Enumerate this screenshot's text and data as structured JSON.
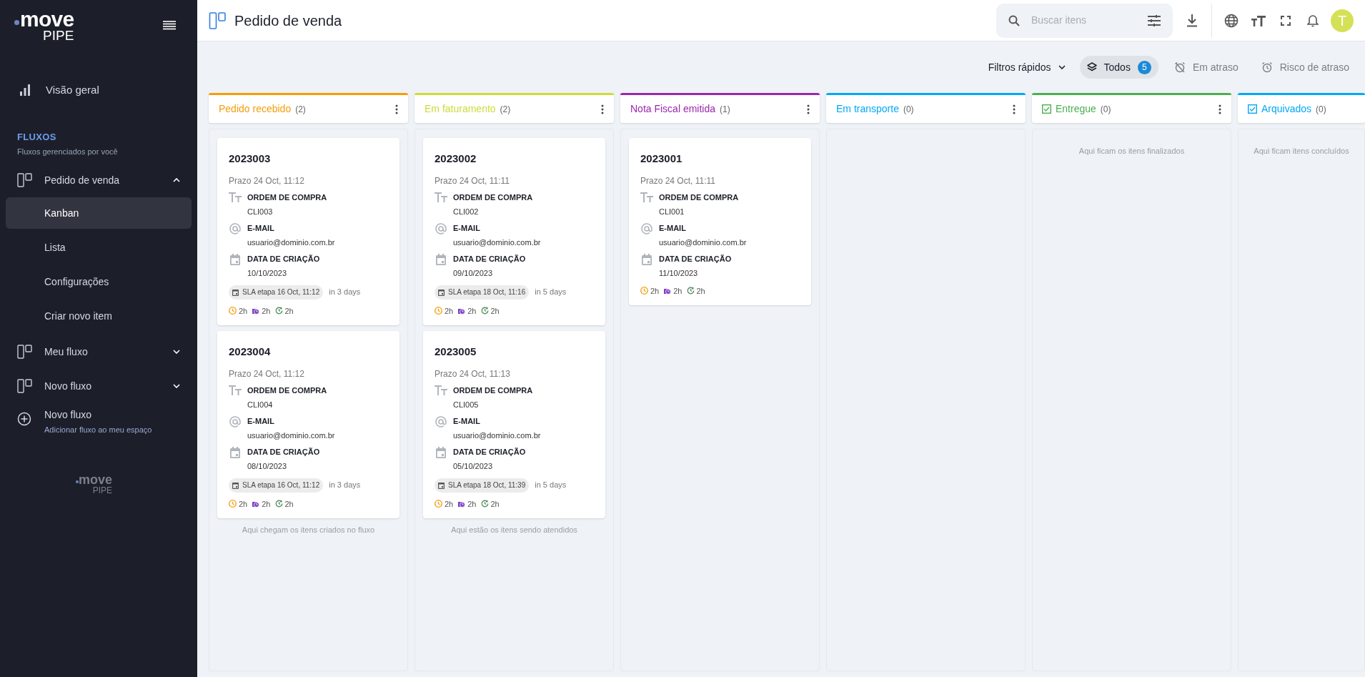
{
  "sidebar": {
    "logo": {
      "word": "move",
      "sub": "PIPE"
    },
    "overview": {
      "label": "Visão geral"
    },
    "section": {
      "title": "FLUXOS",
      "subtitle": "Fluxos gerenciados por você"
    },
    "flows": [
      {
        "label": "Pedido de venda",
        "expanded": true,
        "children": [
          {
            "label": "Kanban",
            "selected": true
          },
          {
            "label": "Lista",
            "selected": false
          },
          {
            "label": "Configurações",
            "selected": false
          },
          {
            "label": "Criar novo item",
            "selected": false
          }
        ]
      },
      {
        "label": "Meu fluxo",
        "expanded": false
      },
      {
        "label": "Novo fluxo",
        "expanded": false
      }
    ],
    "add_flow": {
      "label": "Novo fluxo",
      "subtitle": "Adicionar fluxo ao meu espaço"
    },
    "footer_logo": {
      "word": "move",
      "sub": "PIPE"
    }
  },
  "header": {
    "title": "Pedido de venda",
    "search": {
      "placeholder": "Buscar itens"
    },
    "avatar": "T"
  },
  "filters": {
    "quick": "Filtros rápidos",
    "chips": [
      {
        "kind": "all",
        "label": "Todos",
        "count": "5",
        "selected": true
      },
      {
        "kind": "late",
        "label": "Em atraso",
        "selected": false
      },
      {
        "kind": "risk",
        "label": "Risco de atraso",
        "selected": false
      }
    ]
  },
  "columns": [
    {
      "title": "Pedido recebido",
      "count": "(2)",
      "color": "#f59e0b",
      "done": false,
      "menu": true,
      "hint": "Aqui chegam os itens criados no fluxo",
      "cards": [
        {
          "id": "2023003",
          "deadline": "Prazo 24 Oct, 11:12",
          "fields": [
            {
              "kind": "text",
              "label": "ORDEM DE COMPRA",
              "value": "CLI003"
            },
            {
              "kind": "email",
              "label": "E-MAIL",
              "value": "usuario@dominio.com.br"
            },
            {
              "kind": "date",
              "label": "DATA DE CRIAÇÃO",
              "value": "10/10/2023"
            }
          ],
          "sla": "SLA etapa 16 Oct, 11:12",
          "due": "in 3 days",
          "timers": [
            {
              "kind": "clock",
              "value": "2h"
            },
            {
              "kind": "bag",
              "value": "2h"
            },
            {
              "kind": "refresh",
              "value": "2h"
            }
          ]
        },
        {
          "id": "2023004",
          "deadline": "Prazo 24 Oct, 11:12",
          "fields": [
            {
              "kind": "text",
              "label": "ORDEM DE COMPRA",
              "value": "CLI004"
            },
            {
              "kind": "email",
              "label": "E-MAIL",
              "value": "usuario@dominio.com.br"
            },
            {
              "kind": "date",
              "label": "DATA DE CRIAÇÃO",
              "value": "08/10/2023"
            }
          ],
          "sla": "SLA etapa 16 Oct, 11:12",
          "due": "in 3 days",
          "timers": [
            {
              "kind": "clock",
              "value": "2h"
            },
            {
              "kind": "bag",
              "value": "2h"
            },
            {
              "kind": "refresh",
              "value": "2h"
            }
          ]
        }
      ]
    },
    {
      "title": "Em faturamento",
      "count": "(2)",
      "color": "#cddc39",
      "done": false,
      "menu": true,
      "hint": "Aqui estão os itens sendo atendidos",
      "cards": [
        {
          "id": "2023002",
          "deadline": "Prazo 24 Oct, 11:11",
          "fields": [
            {
              "kind": "text",
              "label": "ORDEM DE COMPRA",
              "value": "CLI002"
            },
            {
              "kind": "email",
              "label": "E-MAIL",
              "value": "usuario@dominio.com.br"
            },
            {
              "kind": "date",
              "label": "DATA DE CRIAÇÃO",
              "value": "09/10/2023"
            }
          ],
          "sla": "SLA etapa 18 Oct, 11:16",
          "due": "in 5 days",
          "timers": [
            {
              "kind": "clock",
              "value": "2h"
            },
            {
              "kind": "bag",
              "value": "2h"
            },
            {
              "kind": "refresh",
              "value": "2h"
            }
          ]
        },
        {
          "id": "2023005",
          "deadline": "Prazo 24 Oct, 11:13",
          "fields": [
            {
              "kind": "text",
              "label": "ORDEM DE COMPRA",
              "value": "CLI005"
            },
            {
              "kind": "email",
              "label": "E-MAIL",
              "value": "usuario@dominio.com.br"
            },
            {
              "kind": "date",
              "label": "DATA DE CRIAÇÃO",
              "value": "05/10/2023"
            }
          ],
          "sla": "SLA etapa 18 Oct, 11:39",
          "due": "in 5 days",
          "timers": [
            {
              "kind": "clock",
              "value": "2h"
            },
            {
              "kind": "bag",
              "value": "2h"
            },
            {
              "kind": "refresh",
              "value": "2h"
            }
          ]
        }
      ]
    },
    {
      "title": "Nota Fiscal emitida",
      "count": "(1)",
      "color": "#9c27b0",
      "done": false,
      "menu": true,
      "cards": [
        {
          "id": "2023001",
          "deadline": "Prazo 24 Oct, 11:11",
          "fields": [
            {
              "kind": "text",
              "label": "ORDEM DE COMPRA",
              "value": "CLI001"
            },
            {
              "kind": "email",
              "label": "E-MAIL",
              "value": "usuario@dominio.com.br"
            },
            {
              "kind": "date",
              "label": "DATA DE CRIAÇÃO",
              "value": "11/10/2023"
            }
          ],
          "timers": [
            {
              "kind": "clock",
              "value": "2h"
            },
            {
              "kind": "bag",
              "value": "2h"
            },
            {
              "kind": "refresh",
              "value": "2h"
            }
          ]
        }
      ]
    },
    {
      "title": "Em transporte",
      "count": "(0)",
      "color": "#03a9f4",
      "done": false,
      "menu": true
    },
    {
      "title": "Entregue",
      "count": "(0)",
      "color": "#4caf50",
      "done": true,
      "menu": true,
      "hint": "Aqui ficam os itens finalizados"
    },
    {
      "title": "Arquivados",
      "count": "(0)",
      "color": "#03a9f4",
      "done": true,
      "menu": false,
      "hint": "Aqui ficam itens concluídos"
    }
  ]
}
